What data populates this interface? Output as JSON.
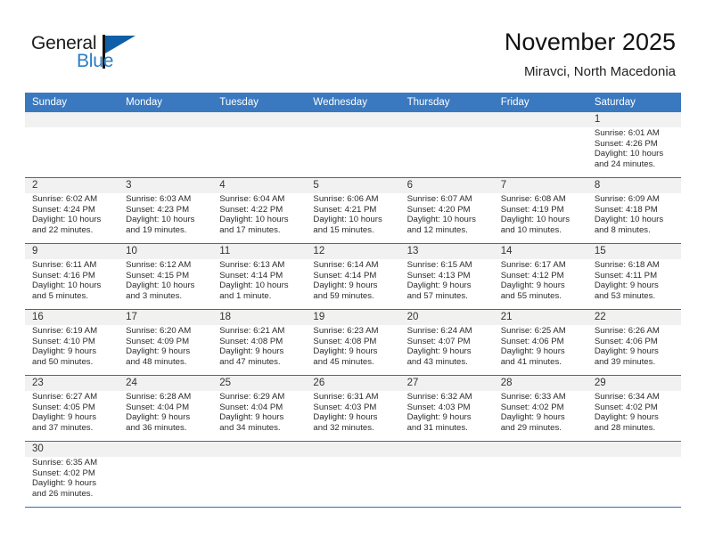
{
  "brand": {
    "name_top": "General",
    "name_bottom": "Blue",
    "accent_color": "#2a7cc7",
    "flag_color": "#0f5fa8"
  },
  "header": {
    "month_title": "November 2025",
    "location": "Miravci, North Macedonia",
    "header_bar_color": "#3a79c0",
    "row_divider_color": "#2f6fb5",
    "daynum_band_color": "#f1f1f1"
  },
  "weekdays": [
    "Sunday",
    "Monday",
    "Tuesday",
    "Wednesday",
    "Thursday",
    "Friday",
    "Saturday"
  ],
  "weeks": [
    [
      {
        "day": "",
        "lines": []
      },
      {
        "day": "",
        "lines": []
      },
      {
        "day": "",
        "lines": []
      },
      {
        "day": "",
        "lines": []
      },
      {
        "day": "",
        "lines": []
      },
      {
        "day": "",
        "lines": []
      },
      {
        "day": "1",
        "lines": [
          "Sunrise: 6:01 AM",
          "Sunset: 4:26 PM",
          "Daylight: 10 hours",
          "and 24 minutes."
        ]
      }
    ],
    [
      {
        "day": "2",
        "lines": [
          "Sunrise: 6:02 AM",
          "Sunset: 4:24 PM",
          "Daylight: 10 hours",
          "and 22 minutes."
        ]
      },
      {
        "day": "3",
        "lines": [
          "Sunrise: 6:03 AM",
          "Sunset: 4:23 PM",
          "Daylight: 10 hours",
          "and 19 minutes."
        ]
      },
      {
        "day": "4",
        "lines": [
          "Sunrise: 6:04 AM",
          "Sunset: 4:22 PM",
          "Daylight: 10 hours",
          "and 17 minutes."
        ]
      },
      {
        "day": "5",
        "lines": [
          "Sunrise: 6:06 AM",
          "Sunset: 4:21 PM",
          "Daylight: 10 hours",
          "and 15 minutes."
        ]
      },
      {
        "day": "6",
        "lines": [
          "Sunrise: 6:07 AM",
          "Sunset: 4:20 PM",
          "Daylight: 10 hours",
          "and 12 minutes."
        ]
      },
      {
        "day": "7",
        "lines": [
          "Sunrise: 6:08 AM",
          "Sunset: 4:19 PM",
          "Daylight: 10 hours",
          "and 10 minutes."
        ]
      },
      {
        "day": "8",
        "lines": [
          "Sunrise: 6:09 AM",
          "Sunset: 4:18 PM",
          "Daylight: 10 hours",
          "and 8 minutes."
        ]
      }
    ],
    [
      {
        "day": "9",
        "lines": [
          "Sunrise: 6:11 AM",
          "Sunset: 4:16 PM",
          "Daylight: 10 hours",
          "and 5 minutes."
        ]
      },
      {
        "day": "10",
        "lines": [
          "Sunrise: 6:12 AM",
          "Sunset: 4:15 PM",
          "Daylight: 10 hours",
          "and 3 minutes."
        ]
      },
      {
        "day": "11",
        "lines": [
          "Sunrise: 6:13 AM",
          "Sunset: 4:14 PM",
          "Daylight: 10 hours",
          "and 1 minute."
        ]
      },
      {
        "day": "12",
        "lines": [
          "Sunrise: 6:14 AM",
          "Sunset: 4:14 PM",
          "Daylight: 9 hours",
          "and 59 minutes."
        ]
      },
      {
        "day": "13",
        "lines": [
          "Sunrise: 6:15 AM",
          "Sunset: 4:13 PM",
          "Daylight: 9 hours",
          "and 57 minutes."
        ]
      },
      {
        "day": "14",
        "lines": [
          "Sunrise: 6:17 AM",
          "Sunset: 4:12 PM",
          "Daylight: 9 hours",
          "and 55 minutes."
        ]
      },
      {
        "day": "15",
        "lines": [
          "Sunrise: 6:18 AM",
          "Sunset: 4:11 PM",
          "Daylight: 9 hours",
          "and 53 minutes."
        ]
      }
    ],
    [
      {
        "day": "16",
        "lines": [
          "Sunrise: 6:19 AM",
          "Sunset: 4:10 PM",
          "Daylight: 9 hours",
          "and 50 minutes."
        ]
      },
      {
        "day": "17",
        "lines": [
          "Sunrise: 6:20 AM",
          "Sunset: 4:09 PM",
          "Daylight: 9 hours",
          "and 48 minutes."
        ]
      },
      {
        "day": "18",
        "lines": [
          "Sunrise: 6:21 AM",
          "Sunset: 4:08 PM",
          "Daylight: 9 hours",
          "and 47 minutes."
        ]
      },
      {
        "day": "19",
        "lines": [
          "Sunrise: 6:23 AM",
          "Sunset: 4:08 PM",
          "Daylight: 9 hours",
          "and 45 minutes."
        ]
      },
      {
        "day": "20",
        "lines": [
          "Sunrise: 6:24 AM",
          "Sunset: 4:07 PM",
          "Daylight: 9 hours",
          "and 43 minutes."
        ]
      },
      {
        "day": "21",
        "lines": [
          "Sunrise: 6:25 AM",
          "Sunset: 4:06 PM",
          "Daylight: 9 hours",
          "and 41 minutes."
        ]
      },
      {
        "day": "22",
        "lines": [
          "Sunrise: 6:26 AM",
          "Sunset: 4:06 PM",
          "Daylight: 9 hours",
          "and 39 minutes."
        ]
      }
    ],
    [
      {
        "day": "23",
        "lines": [
          "Sunrise: 6:27 AM",
          "Sunset: 4:05 PM",
          "Daylight: 9 hours",
          "and 37 minutes."
        ]
      },
      {
        "day": "24",
        "lines": [
          "Sunrise: 6:28 AM",
          "Sunset: 4:04 PM",
          "Daylight: 9 hours",
          "and 36 minutes."
        ]
      },
      {
        "day": "25",
        "lines": [
          "Sunrise: 6:29 AM",
          "Sunset: 4:04 PM",
          "Daylight: 9 hours",
          "and 34 minutes."
        ]
      },
      {
        "day": "26",
        "lines": [
          "Sunrise: 6:31 AM",
          "Sunset: 4:03 PM",
          "Daylight: 9 hours",
          "and 32 minutes."
        ]
      },
      {
        "day": "27",
        "lines": [
          "Sunrise: 6:32 AM",
          "Sunset: 4:03 PM",
          "Daylight: 9 hours",
          "and 31 minutes."
        ]
      },
      {
        "day": "28",
        "lines": [
          "Sunrise: 6:33 AM",
          "Sunset: 4:02 PM",
          "Daylight: 9 hours",
          "and 29 minutes."
        ]
      },
      {
        "day": "29",
        "lines": [
          "Sunrise: 6:34 AM",
          "Sunset: 4:02 PM",
          "Daylight: 9 hours",
          "and 28 minutes."
        ]
      }
    ],
    [
      {
        "day": "30",
        "lines": [
          "Sunrise: 6:35 AM",
          "Sunset: 4:02 PM",
          "Daylight: 9 hours",
          "and 26 minutes."
        ]
      },
      {
        "day": "",
        "lines": []
      },
      {
        "day": "",
        "lines": []
      },
      {
        "day": "",
        "lines": []
      },
      {
        "day": "",
        "lines": []
      },
      {
        "day": "",
        "lines": []
      },
      {
        "day": "",
        "lines": []
      }
    ]
  ]
}
